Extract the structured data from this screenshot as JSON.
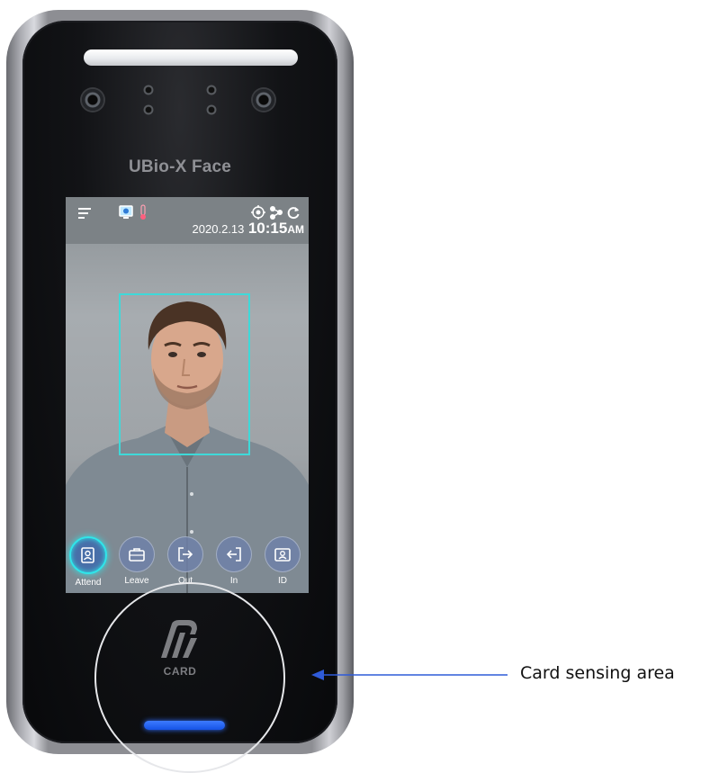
{
  "device": {
    "brand": "UBio-X Face",
    "card_text": "CARD",
    "led_color": "#1f5eff"
  },
  "screen": {
    "date": "2020.2.13",
    "time": "10:15",
    "ampm": "AM",
    "status_icons": [
      "menu-icon",
      "monitor-icon",
      "thermometer-icon",
      "location-icon",
      "network-icon",
      "sync-icon"
    ],
    "face_box_color": "#3ed9d9",
    "actions": [
      {
        "label": "Attend",
        "icon": "attend-card-icon",
        "active": true
      },
      {
        "label": "Leave",
        "icon": "briefcase-icon",
        "active": false
      },
      {
        "label": "Out",
        "icon": "exit-icon",
        "active": false
      },
      {
        "label": "In",
        "icon": "enter-icon",
        "active": false
      },
      {
        "label": "ID",
        "icon": "id-card-icon",
        "active": false
      }
    ]
  },
  "callout": {
    "label": "Card sensing area",
    "arrow_color": "#2f5bd9"
  }
}
